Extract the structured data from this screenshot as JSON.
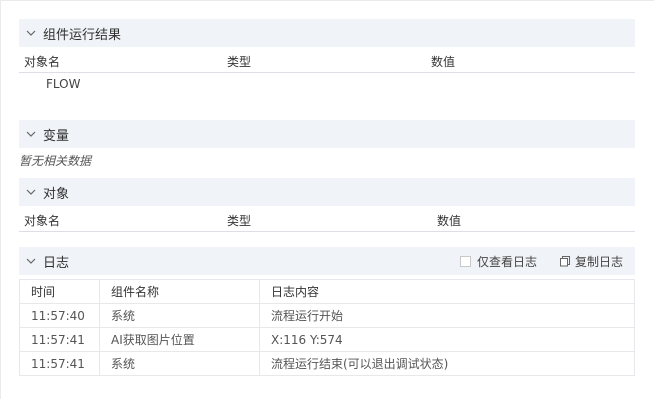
{
  "component_results": {
    "title": "组件运行结果",
    "columns": [
      "对象名",
      "类型",
      "数值"
    ],
    "rows": [
      "FLOW"
    ]
  },
  "variables": {
    "title": "变量",
    "empty_text": "暂无相关数据"
  },
  "objects": {
    "title": "对象",
    "columns": [
      "对象名",
      "类型",
      "数值"
    ]
  },
  "log": {
    "title": "日志",
    "only_view_log_label": "仅查看日志",
    "copy_log_label": "复制日志",
    "columns": [
      "时间",
      "组件名称",
      "日志内容"
    ],
    "rows": [
      [
        "11:57:40",
        "系统",
        "流程运行开始"
      ],
      [
        "11:57:41",
        "AI获取图片位置",
        "X:116 Y:574"
      ],
      [
        "11:57:41",
        "系统",
        "流程运行结束(可以退出调试状态)"
      ]
    ]
  }
}
